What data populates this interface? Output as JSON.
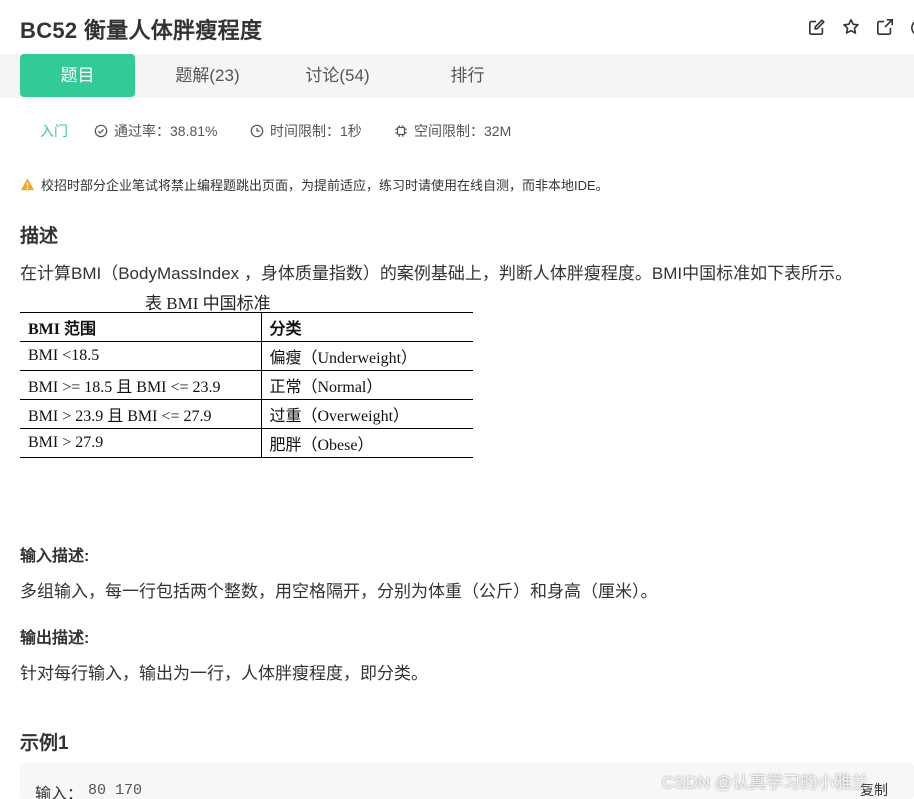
{
  "problem": {
    "id_title": "BC52  衡量人体胖瘦程度"
  },
  "header_icons": [
    "edit-icon",
    "star-icon",
    "external-link-icon",
    "share-icon"
  ],
  "tabs": [
    {
      "label": "题目",
      "active": true
    },
    {
      "label": "题解(23)",
      "active": false
    },
    {
      "label": "讨论(54)",
      "active": false
    },
    {
      "label": "排行",
      "active": false
    }
  ],
  "meta": {
    "level": "入门",
    "pass_rate": "通过率：38.81%",
    "time_limit": "时间限制：1秒",
    "space_limit": "空间限制：32M"
  },
  "warning": "校招时部分企业笔试将禁止编程题跳出页面，为提前适应，练习时请使用在线自测，而非本地IDE。",
  "description": {
    "heading": "描述",
    "text": "在计算BMI（BodyMassIndex ，身体质量指数）的案例基础上，判断人体胖瘦程度。BMI中国标准如下表所示。",
    "table": {
      "caption": "表 BMI 中国标准",
      "headers": [
        "BMI 范围",
        "分类"
      ],
      "rows": [
        [
          "BMI <18.5",
          "偏瘦（Underweight）"
        ],
        [
          "BMI >= 18.5 且 BMI <= 23.9",
          "正常（Normal）"
        ],
        [
          "BMI > 23.9 且 BMI <= 27.9",
          "过重（Overweight）"
        ],
        [
          "BMI > 27.9",
          "肥胖（Obese）"
        ]
      ]
    }
  },
  "input_desc": {
    "heading": "输入描述:",
    "text": "多组输入，每一行包括两个整数，用空格隔开，分别为体重（公斤）和身高（厘米）。"
  },
  "output_desc": {
    "heading": "输出描述:",
    "text": "针对每行输入，输出为一行，人体胖瘦程度，即分类。"
  },
  "example": {
    "heading": "示例1",
    "input_label": "输入：",
    "input_value": "80 170",
    "copy_label": "复制"
  },
  "watermark": "CSDN @认真学习的小雅兰.",
  "colors": {
    "accent": "#32ca99",
    "tab_bar_bg": "#f4f5f6",
    "warning": "#f5a623",
    "text": "#333333"
  }
}
